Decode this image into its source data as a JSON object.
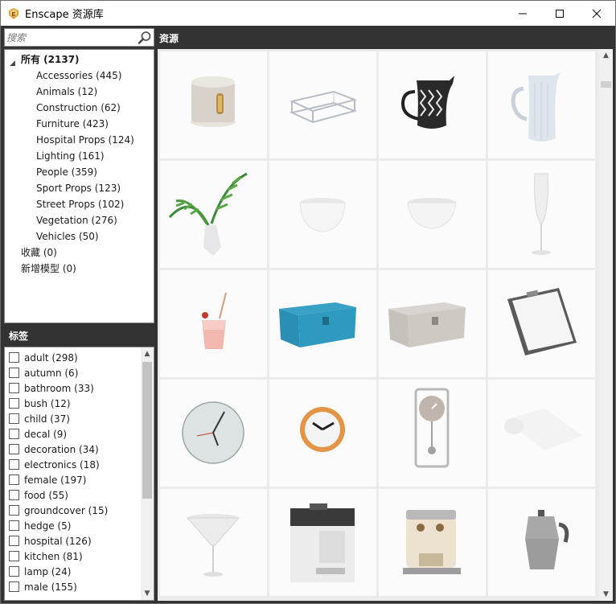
{
  "window": {
    "title": "Enscape 资源库",
    "icon": "enscape-logo-icon",
    "controls": [
      "minimize-icon",
      "maximize-icon",
      "close-icon"
    ]
  },
  "search": {
    "placeholder": "搜索",
    "value": "",
    "icon": "magnifier-icon"
  },
  "tree": {
    "root": "所有 (2137)",
    "categories": [
      "Accessories (445)",
      "Animals (12)",
      "Construction (62)",
      "Furniture (423)",
      "Hospital Props (124)",
      "Lighting (161)",
      "People (359)",
      "Sport Props (123)",
      "Street Props (102)",
      "Vegetation (276)",
      "Vehicles (50)"
    ],
    "extra": [
      "收藏 (0)",
      "新增模型 (0)"
    ]
  },
  "tags": {
    "header": "标签",
    "items": [
      "adult (298)",
      "autumn (6)",
      "bathroom (33)",
      "bush (12)",
      "child (37)",
      "decal (9)",
      "decoration (34)",
      "electronics (18)",
      "female (197)",
      "food (55)",
      "groundcover (15)",
      "hedge (5)",
      "hospital (126)",
      "kitchen (81)",
      "lamp (24)",
      "male (155)"
    ]
  },
  "assets": {
    "header": "资源",
    "items": [
      "canister-icon",
      "glass-tray-icon",
      "patterned-pitcher-icon",
      "white-pitcher-icon",
      "palm-vase-icon",
      "white-bowl-icon",
      "white-bowl-icon",
      "champagne-flute-icon",
      "cocktail-glass-icon",
      "blue-chest-icon",
      "grey-chest-icon",
      "clipboard-icon",
      "wall-clock-icon",
      "orange-clock-icon",
      "pendulum-clock-icon",
      "rolled-towel-icon",
      "martini-glass-icon",
      "coffee-machine-icon",
      "espresso-machine-icon",
      "moka-pot-icon"
    ]
  }
}
